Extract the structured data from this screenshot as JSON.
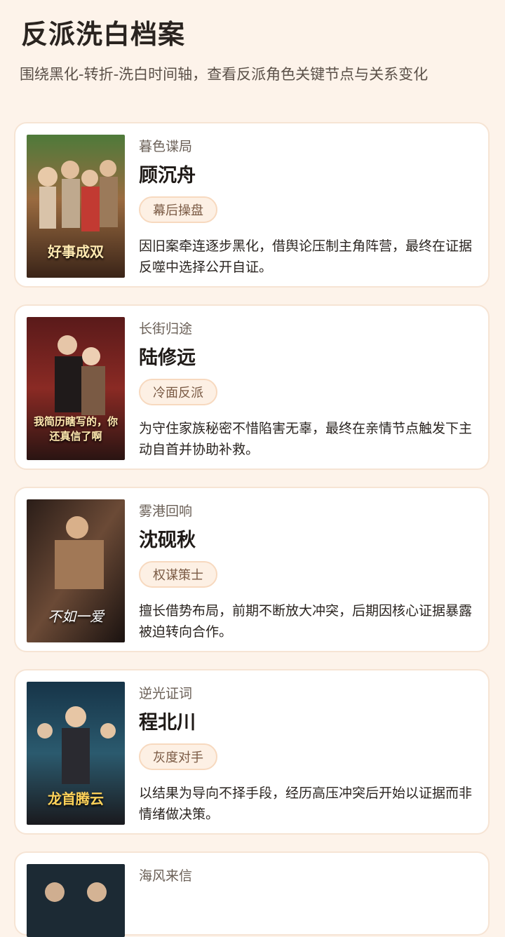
{
  "header": {
    "title": "反派洗白档案",
    "subtitle": "围绕黑化-转折-洗白时间轴，查看反派角色关键节点与关系变化"
  },
  "cards": [
    {
      "series": "暮色谍局",
      "name": "顾沉舟",
      "tag": "幕后操盘",
      "desc": "因旧案牵连逐步黑化，借舆论压制主角阵营，最终在证据反噬中选择公开自证。",
      "poster_text": "好事成双"
    },
    {
      "series": "长街归途",
      "name": "陆修远",
      "tag": "冷面反派",
      "desc": "为守住家族秘密不惜陷害无辜，最终在亲情节点触发下主动自首并协助补救。",
      "poster_text": "我简历瞎写的，你还真信了啊"
    },
    {
      "series": "雾港回响",
      "name": "沈砚秋",
      "tag": "权谋策士",
      "desc": "擅长借势布局，前期不断放大冲突，后期因核心证据暴露被迫转向合作。",
      "poster_text": "不如一爱"
    },
    {
      "series": "逆光证词",
      "name": "程北川",
      "tag": "灰度对手",
      "desc": "以结果为导向不择手段，经历高压冲突后开始以证据而非情绪做决策。",
      "poster_text": "龙首腾云"
    },
    {
      "series": "海风来信",
      "name": "",
      "tag": "",
      "desc": "",
      "poster_text": ""
    }
  ]
}
